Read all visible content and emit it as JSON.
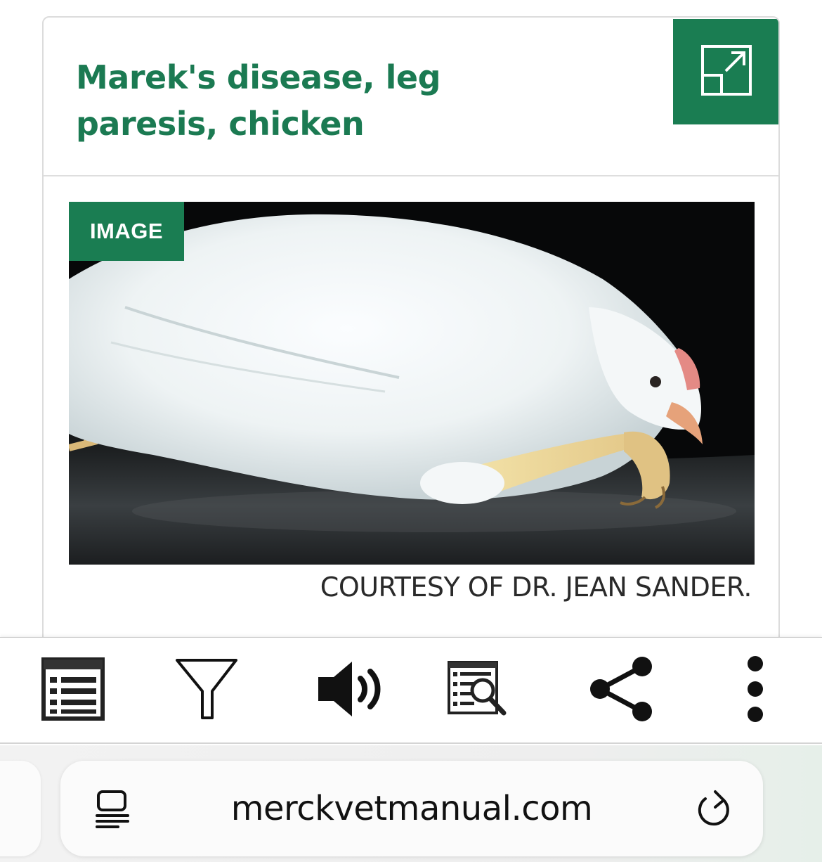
{
  "card": {
    "title": "Marek's disease, leg paresis, chicken",
    "expand_icon": "expand-icon",
    "image_tag": "IMAGE",
    "credit": "COURTESY OF DR. JEAN SANDER.",
    "accent_color": "#1a7d52"
  },
  "toolbar": {
    "items": [
      {
        "icon": "table-of-contents-icon"
      },
      {
        "icon": "filter-icon"
      },
      {
        "icon": "audio-icon"
      },
      {
        "icon": "find-in-page-icon"
      },
      {
        "icon": "share-icon"
      },
      {
        "icon": "more-vertical-icon"
      }
    ]
  },
  "browser": {
    "url": "merckvetmanual.com",
    "reader_icon": "reader-mode-icon",
    "reload_icon": "reload-icon"
  }
}
